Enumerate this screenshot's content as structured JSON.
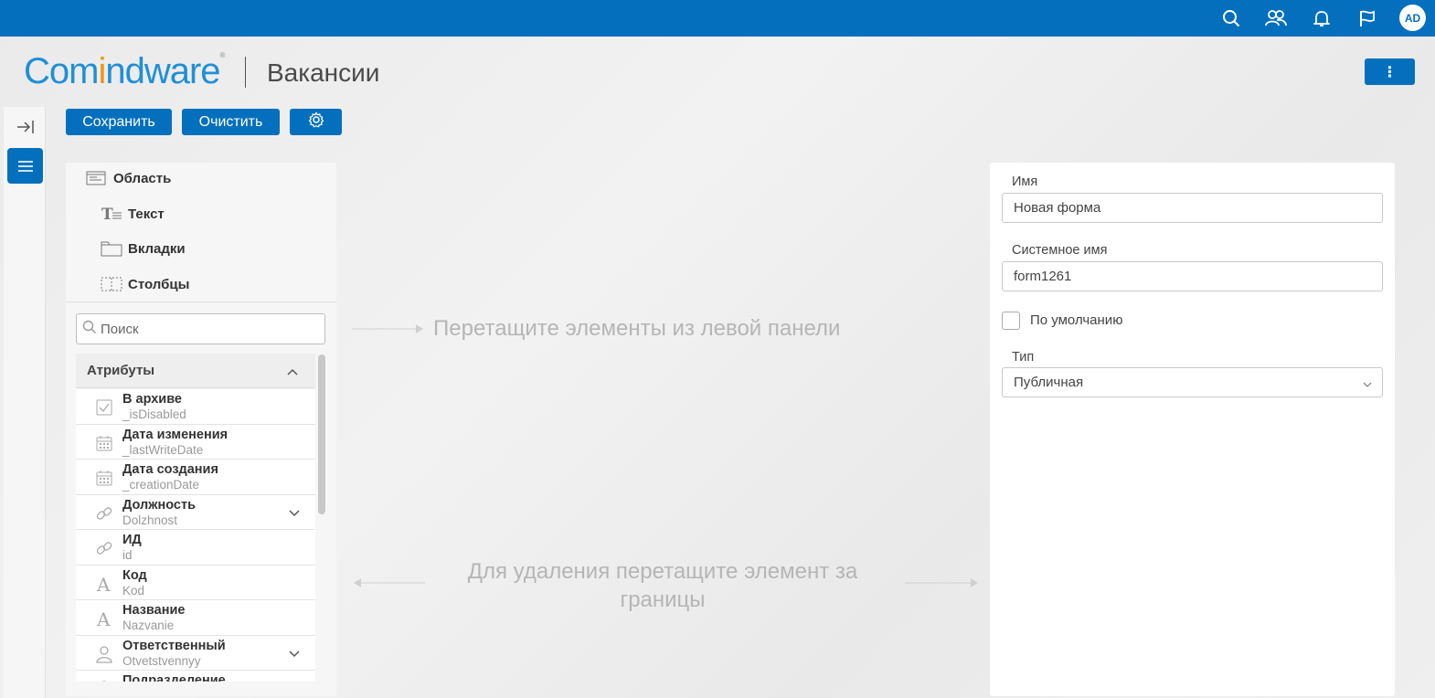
{
  "topbar": {
    "icons": [
      "search-icon",
      "users-icon",
      "bell-icon",
      "flag-icon"
    ],
    "avatar_initials": "AD",
    "color": "#0470bd"
  },
  "header": {
    "logo_part1": "Com",
    "logo_part2": "i",
    "logo_part3": "ndware",
    "logo_reg": "®",
    "title": "Вакансии",
    "more_label": "⋮"
  },
  "toolbar": {
    "save_label": "Сохранить",
    "clear_label": "Очистить",
    "settings_icon": "gear-icon"
  },
  "left_panel": {
    "structure": [
      {
        "label": "Область",
        "icon": "area-icon"
      },
      {
        "label": "Текст",
        "icon": "text-icon"
      },
      {
        "label": "Вкладки",
        "icon": "tabs-icon"
      },
      {
        "label": "Столбцы",
        "icon": "columns-icon"
      }
    ],
    "search_placeholder": "Поиск",
    "attributes_header": "Атрибуты",
    "attributes": [
      {
        "name": "В архиве",
        "system": "_isDisabled",
        "icon": "checkbox-icon",
        "expandable": false
      },
      {
        "name": "Дата изменения",
        "system": "_lastWriteDate",
        "icon": "calendar-icon",
        "expandable": false
      },
      {
        "name": "Дата создания",
        "system": "_creationDate",
        "icon": "calendar-icon",
        "expandable": false
      },
      {
        "name": "Должность",
        "system": "Dolzhnost",
        "icon": "link-icon",
        "expandable": true
      },
      {
        "name": "ИД",
        "system": "id",
        "icon": "link-icon",
        "expandable": false
      },
      {
        "name": "Код",
        "system": "Kod",
        "icon": "text-a-icon",
        "expandable": false
      },
      {
        "name": "Название",
        "system": "Nazvanie",
        "icon": "text-a-icon",
        "expandable": false
      },
      {
        "name": "Ответственный",
        "system": "Otvetstvennyy",
        "icon": "user-icon",
        "expandable": true
      },
      {
        "name": "Подразделение",
        "system": "",
        "icon": "user-icon",
        "expandable": false
      }
    ]
  },
  "canvas": {
    "drop_hint": "Перетащите элементы из левой панели",
    "delete_hint": "Для удаления перетащите элемент за границы"
  },
  "right_panel": {
    "name_label": "Имя",
    "name_value": "Новая форма",
    "system_name_label": "Системное имя",
    "system_name_value": "form1261",
    "default_label": "По умолчанию",
    "default_checked": false,
    "type_label": "Тип",
    "type_value": "Публичная"
  }
}
